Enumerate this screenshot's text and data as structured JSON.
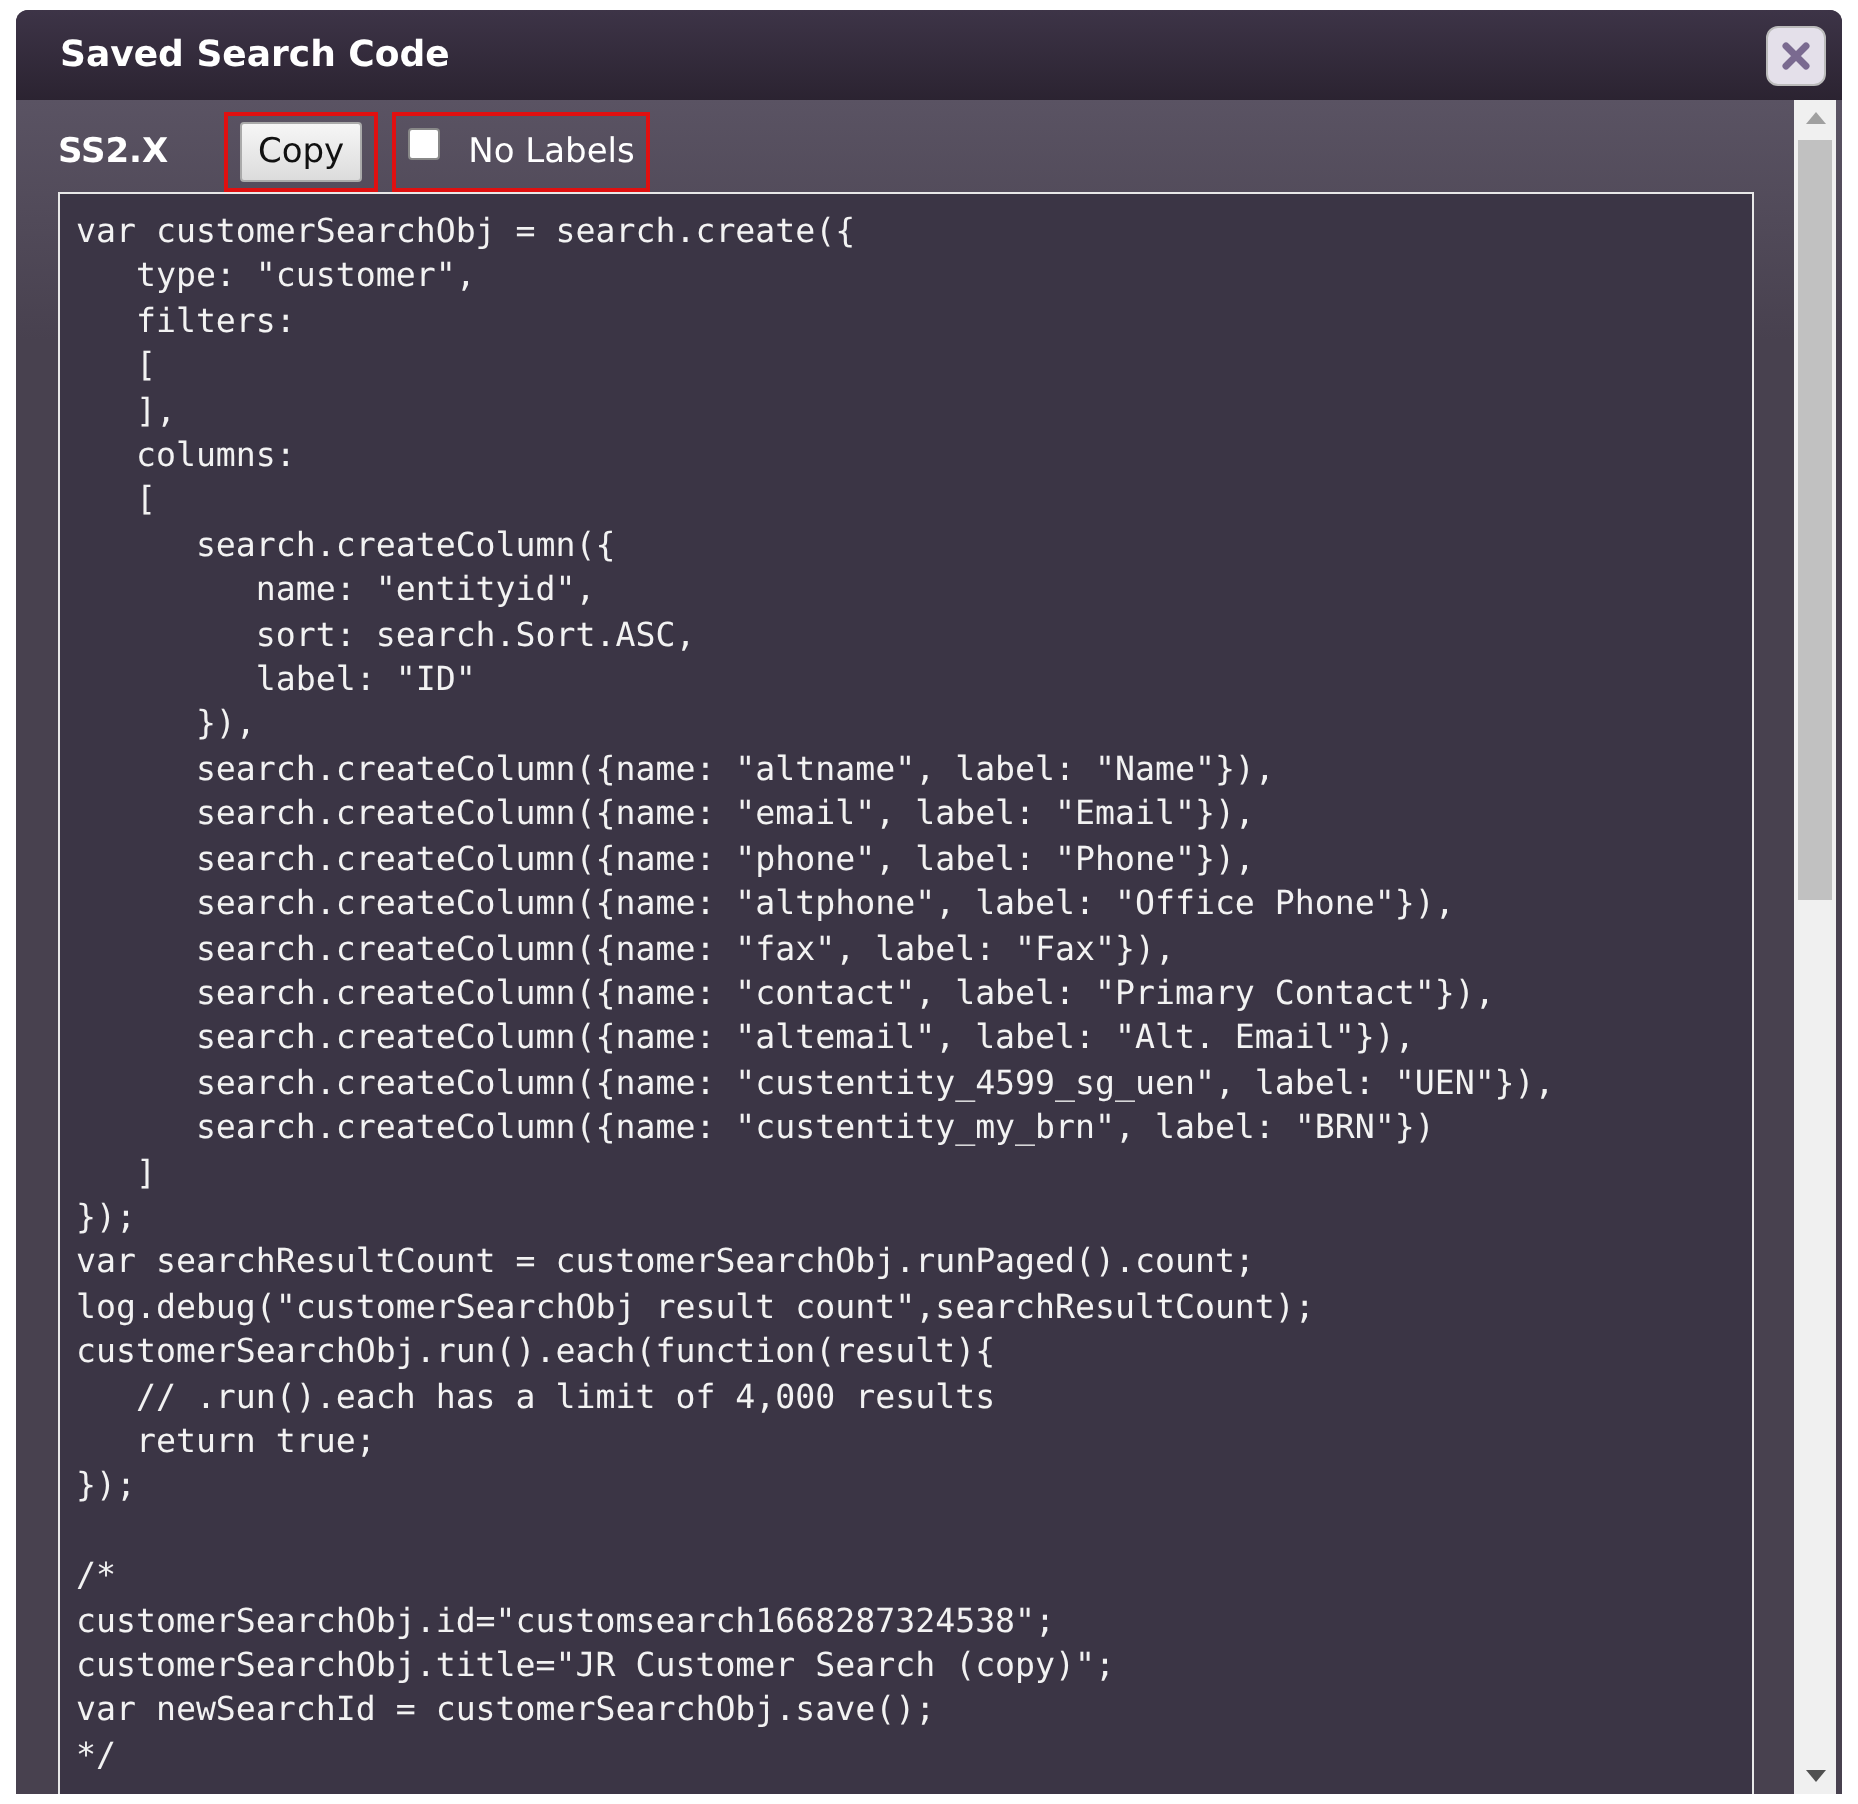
{
  "window": {
    "title": "Saved Search Code"
  },
  "toolbar": {
    "version": "SS2.X",
    "copy_button": {
      "label": "Copy",
      "highlighted": true
    },
    "no_labels": {
      "label": "No Labels",
      "checked": false,
      "highlighted": true
    }
  },
  "code_blocks": [
    {
      "lines": [
        "var customerSearchObj = search.create({",
        "   type: \"customer\",",
        "   filters:",
        "   [",
        "   ],",
        "   columns:",
        "   [",
        "      search.createColumn({",
        "         name: \"entityid\",",
        "         sort: search.Sort.ASC,",
        "         label: \"ID\"",
        "      }),",
        "      search.createColumn({name: \"altname\", label: \"Name\"}),",
        "      search.createColumn({name: \"email\", label: \"Email\"}),",
        "      search.createColumn({name: \"phone\", label: \"Phone\"}),",
        "      search.createColumn({name: \"altphone\", label: \"Office Phone\"}),",
        "      search.createColumn({name: \"fax\", label: \"Fax\"}),",
        "      search.createColumn({name: \"contact\", label: \"Primary Contact\"}),",
        "      search.createColumn({name: \"altemail\", label: \"Alt. Email\"}),",
        "      search.createColumn({name: \"custentity_4599_sg_uen\", label: \"UEN\"}),",
        "      search.createColumn({name: \"custentity_my_brn\", label: \"BRN\"})",
        "   ]",
        "});",
        "var searchResultCount = customerSearchObj.runPaged().count;",
        "log.debug(\"customerSearchObj result count\",searchResultCount);",
        "customerSearchObj.run().each(function(result){",
        "   // .run().each has a limit of 4,000 results",
        "   return true;",
        "});"
      ]
    },
    {
      "lines": [
        "/*",
        "customerSearchObj.id=\"customsearch1668287324538\";",
        "customerSearchObj.title=\"JR Customer Search (copy)\";",
        "var newSearchId = customerSearchObj.save();",
        "*/"
      ]
    }
  ]
}
